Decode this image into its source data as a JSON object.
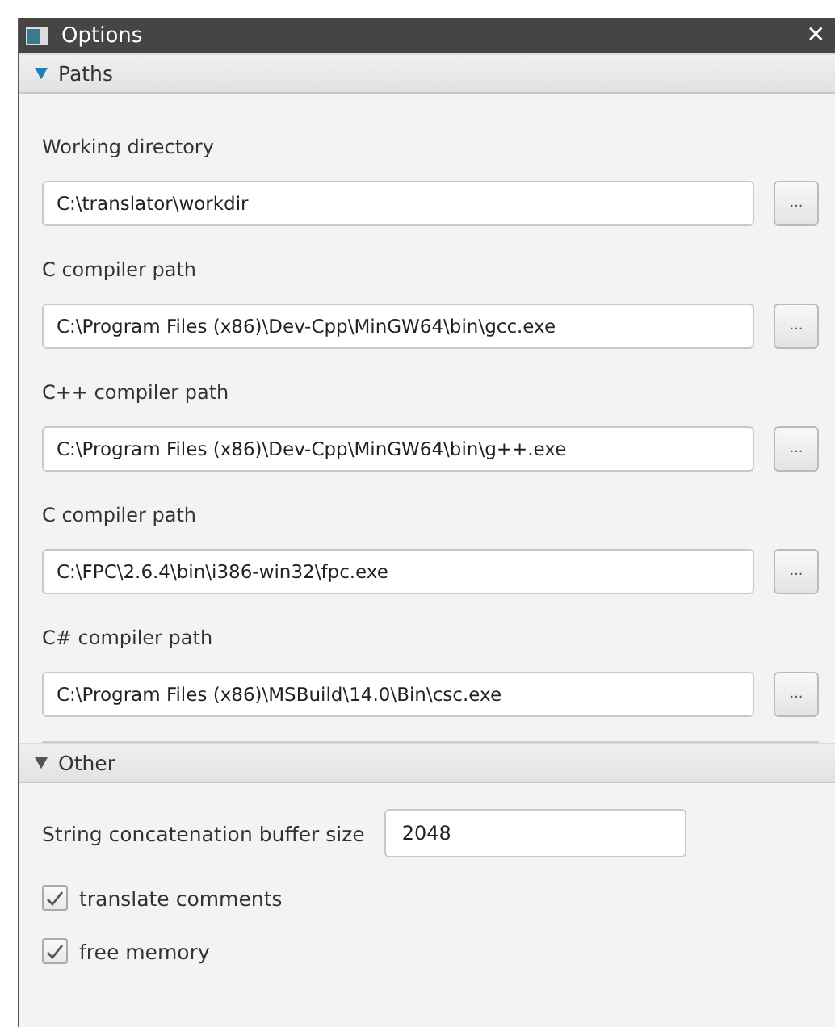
{
  "window": {
    "title": "Options",
    "close": "✕"
  },
  "sections": [
    {
      "title": "Paths",
      "expanded": true,
      "focused": true,
      "kind": "paths",
      "items": [
        {
          "label": "Working directory",
          "value": "C:\\translator\\workdir",
          "browse": "..."
        },
        {
          "label": "C compiler path",
          "value": "C:\\Program Files (x86)\\Dev-Cpp\\MinGW64\\bin\\gcc.exe",
          "browse": "..."
        },
        {
          "label": "C++ compiler path",
          "value": "C:\\Program Files (x86)\\Dev-Cpp\\MinGW64\\bin\\g++.exe",
          "browse": "..."
        },
        {
          "label": "C compiler path",
          "value": "C:\\FPC\\2.6.4\\bin\\i386-win32\\fpc.exe",
          "browse": "..."
        },
        {
          "label": "C# compiler path",
          "value": "C:\\Program Files (x86)\\MSBuild\\14.0\\Bin\\csc.exe",
          "browse": "..."
        }
      ]
    },
    {
      "title": "Other",
      "expanded": true,
      "focused": false,
      "kind": "other",
      "buffer": {
        "label": "String concatenation buffer size",
        "value": "2048"
      },
      "options": [
        {
          "label": "translate comments",
          "checked": true
        },
        {
          "label": "free memory",
          "checked": true
        }
      ]
    }
  ]
}
